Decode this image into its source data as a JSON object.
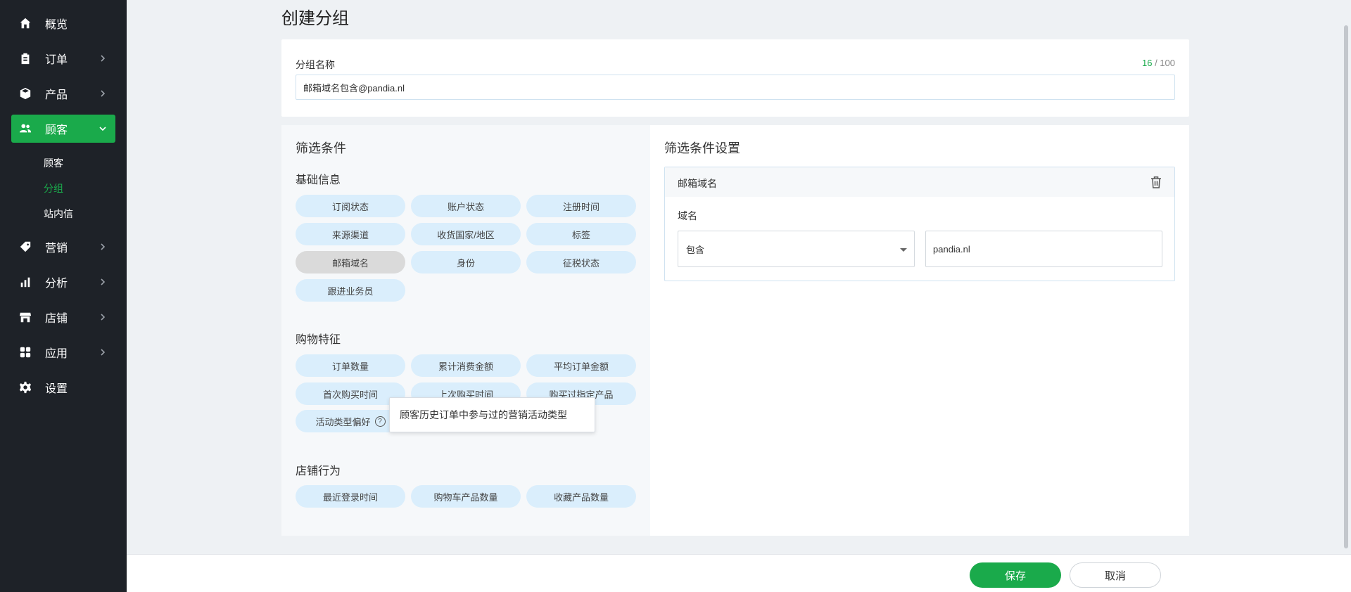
{
  "sidebar": {
    "items": [
      {
        "label": "概览",
        "icon": "home-icon"
      },
      {
        "label": "订单",
        "icon": "clipboard-icon"
      },
      {
        "label": "产品",
        "icon": "box-icon"
      },
      {
        "label": "顾客",
        "icon": "users-icon"
      },
      {
        "label": "营销",
        "icon": "tag-icon"
      },
      {
        "label": "分析",
        "icon": "bar-chart-icon"
      },
      {
        "label": "店铺",
        "icon": "store-icon"
      },
      {
        "label": "应用",
        "icon": "apps-icon"
      },
      {
        "label": "设置",
        "icon": "gear-icon"
      }
    ],
    "subitems": [
      "顾客",
      "分组",
      "站内信"
    ],
    "active_item": "顾客",
    "active_subitem": "分组"
  },
  "page": {
    "title": "创建分组"
  },
  "group_name": {
    "label": "分组名称",
    "value": "邮箱域名包含@pandia.nl",
    "count": "16",
    "separator": " / ",
    "max": "100"
  },
  "filters": {
    "title": "筛选条件",
    "basic": {
      "title": "基础信息",
      "chips": [
        "订阅状态",
        "账户状态",
        "注册时间",
        "来源渠道",
        "收货国家/地区",
        "标签",
        "邮箱域名",
        "身份",
        "征税状态",
        "跟进业务员"
      ]
    },
    "shopping": {
      "title": "购物特征",
      "chips": [
        "订单数量",
        "累计消费金额",
        "平均订单金额",
        "首次购买时间",
        "上次购买时间",
        "购买过指定产品",
        "活动类型偏好"
      ]
    },
    "store": {
      "title": "店铺行为",
      "chips": [
        "最近登录时间",
        "购物车产品数量",
        "收藏产品数量"
      ]
    },
    "tooltip": "顾客历史订单中参与过的营销活动类型",
    "help_mark": "?"
  },
  "settings": {
    "title": "筛选条件设置",
    "condition": {
      "name": "邮箱域名",
      "field_label": "域名",
      "operator": "包含",
      "value": "pandia.nl"
    }
  },
  "footer": {
    "save": "保存",
    "cancel": "取消"
  },
  "colors": {
    "accent": "#1aaa4b",
    "sidebar": "#1e2228",
    "chip": "#daeefc"
  }
}
